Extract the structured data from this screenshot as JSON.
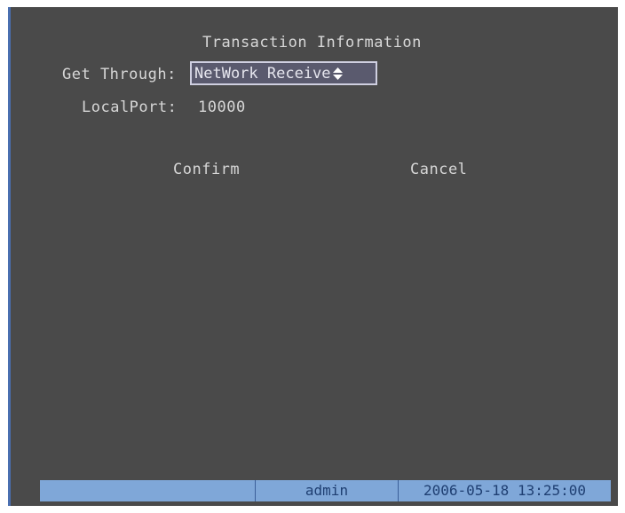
{
  "dialog": {
    "title": "Transaction Information",
    "get_through_label": "Get Through:",
    "get_through_value": "NetWork Receive",
    "localport_label": "LocalPort:",
    "localport_value": "10000",
    "confirm_label": "Confirm",
    "cancel_label": "Cancel"
  },
  "status_bar": {
    "user": "admin",
    "datetime": "2006-05-18 13:25:00"
  },
  "icons": {
    "select_arrow": "up-down-arrows-icon"
  },
  "colors": {
    "background": "#4a4a4a",
    "status_bar": "#7fa7d8",
    "text": "#d7d7d7",
    "select_border": "#cfcfe0"
  }
}
